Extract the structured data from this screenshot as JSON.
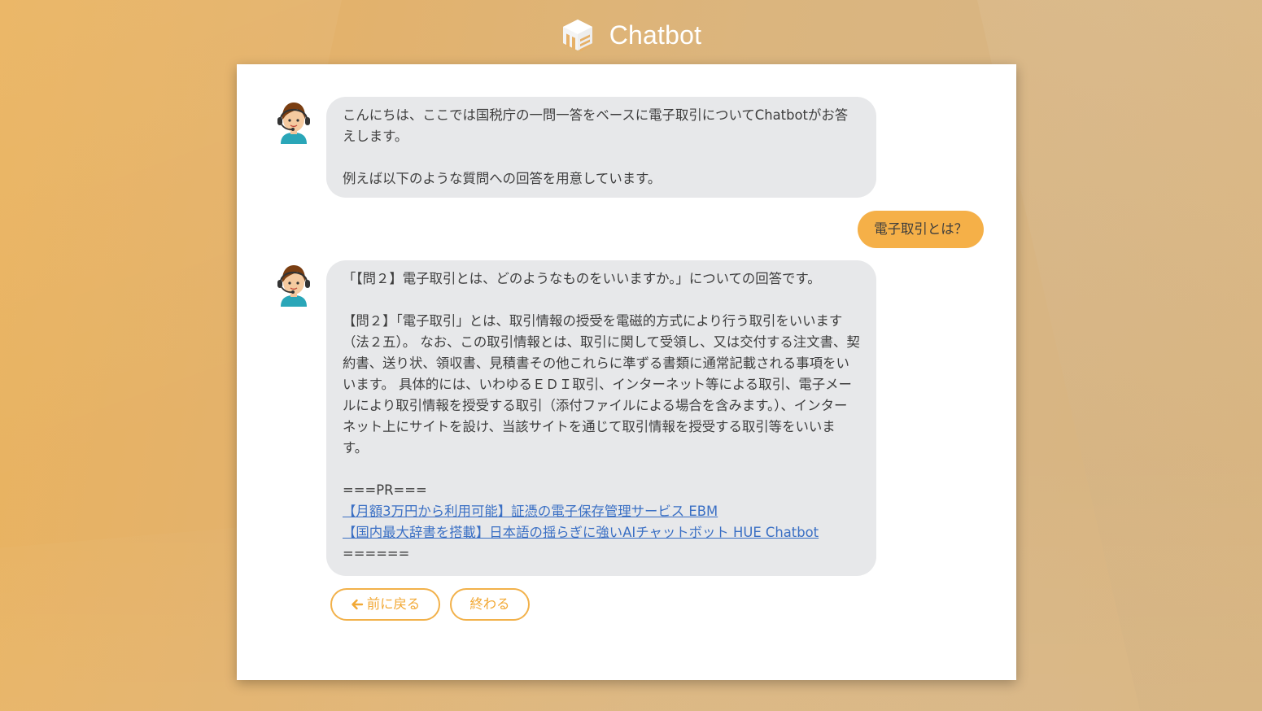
{
  "app": {
    "title": "Chatbot",
    "logo_icon": "hue-cube-logo-icon"
  },
  "colors": {
    "accent": "#f5b048",
    "button_border": "#f2b14a",
    "bot_bubble": "#e7e8ea",
    "link": "#3a6fc4"
  },
  "messages": [
    {
      "sender": "bot",
      "avatar_icon": "operator-headset-avatar-icon",
      "paragraphs": [
        "こんにちは、ここでは国税庁の一問一答をベースに電子取引についてChatbotがお答えします。",
        "例えば以下のような質問への回答を用意しています。"
      ]
    },
    {
      "sender": "user",
      "text": "電子取引とは？"
    },
    {
      "sender": "bot",
      "avatar_icon": "operator-headset-avatar-icon",
      "paragraphs": [
        "「【問２】電子取引とは、どのようなものをいいますか。」についての回答です。",
        "【問２】「電子取引」とは、取引情報の授受を電磁的方式により行う取引をいいます（法２五）。 なお、この取引情報とは、取引に関して受領し、又は交付する注文書、契約書、送り状、領収書、見積書その他これらに準ずる書類に通常記載される事項をいいます。 具体的には、いわゆるＥＤＩ取引、インターネット等による取引、電子メールにより取引情報を授受する取引（添付ファイルによる場合を含みます。）、インターネット上にサイトを設け、当該サイトを通じて取引情報を授受する取引等をいいます。"
      ],
      "pr_header": "===PR===",
      "links": [
        "【月額3万円から利用可能】証憑の電子保存管理サービス EBM",
        "【国内最大辞書を搭載】日本語の揺らぎに強いAIチャットボット HUE Chatbot"
      ],
      "pr_footer": "======"
    }
  ],
  "actions": {
    "back_label": "前に戻る",
    "back_icon": "arrow-left-icon",
    "end_label": "終わる"
  }
}
